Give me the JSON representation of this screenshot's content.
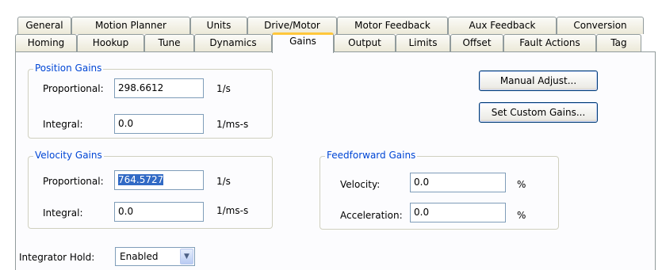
{
  "tabs": {
    "row1": [
      "General",
      "Motion Planner",
      "Units",
      "Drive/Motor",
      "Motor Feedback",
      "Aux Feedback",
      "Conversion"
    ],
    "row2": [
      "Homing",
      "Hookup",
      "Tune",
      "Dynamics",
      "Gains",
      "Output",
      "Limits",
      "Offset",
      "Fault Actions",
      "Tag"
    ],
    "active": "Gains"
  },
  "position_gains": {
    "title": "Position Gains",
    "proportional_label": "Proportional:",
    "proportional_value": "298.6612",
    "proportional_unit": "1/s",
    "integral_label": "Integral:",
    "integral_value": "0.0",
    "integral_unit": "1/ms-s"
  },
  "velocity_gains": {
    "title": "Velocity Gains",
    "proportional_label": "Proportional:",
    "proportional_value": "764.5727",
    "proportional_unit": "1/s",
    "integral_label": "Integral:",
    "integral_value": "0.0",
    "integral_unit": "1/ms-s"
  },
  "feedforward_gains": {
    "title": "Feedforward Gains",
    "velocity_label": "Velocity:",
    "velocity_value": "0.0",
    "velocity_unit": "%",
    "acceleration_label": "Acceleration:",
    "acceleration_value": "0.0",
    "acceleration_unit": "%"
  },
  "buttons": {
    "manual_adjust": "Manual Adjust...",
    "set_custom_gains": "Set Custom Gains..."
  },
  "integrator_hold": {
    "label": "Integrator Hold:",
    "value": "Enabled",
    "arrow_icon": "chevron-down-icon"
  }
}
